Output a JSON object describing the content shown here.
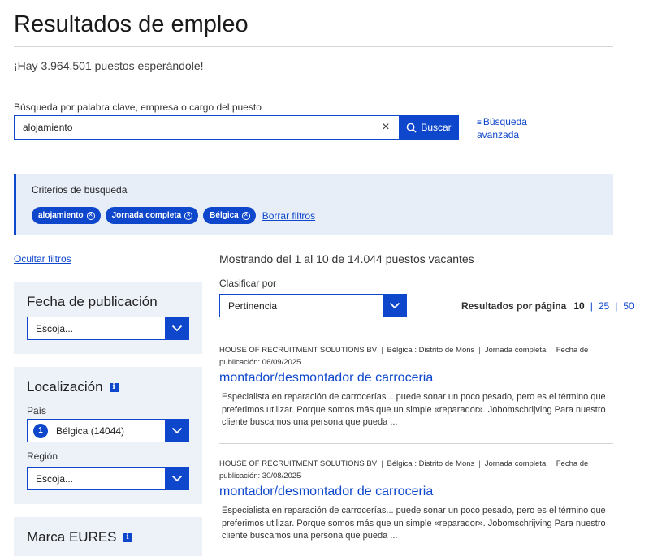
{
  "header": {
    "title": "Resultados de empleo",
    "subtitle": "¡Hay 3.964.501 puestos esperándole!"
  },
  "search": {
    "label": "Búsqueda por palabra clave, empresa o cargo del puesto",
    "value": "alojamiento",
    "clear_icon": "×",
    "button_label": "Buscar",
    "advanced_icon": "≡",
    "advanced_label": "Búsqueda avanzada"
  },
  "criteria": {
    "title": "Criterios de búsqueda",
    "chips": [
      "alojamiento",
      "Jornada completa",
      "Bélgica"
    ],
    "clear_label": "Borrar filtros"
  },
  "filters": {
    "hide_label": "Ocultar filtros",
    "publication_date": {
      "title": "Fecha de publicación",
      "value": "Escoja..."
    },
    "location": {
      "title": "Localización",
      "country_label": "País",
      "country_count": "1",
      "country_value": "Bélgica (14044)",
      "region_label": "Región",
      "region_value": "Escoja..."
    },
    "eures": {
      "title": "Marca EURES"
    }
  },
  "results": {
    "showing": "Mostrando del 1 al 10 de 14.044 puestos vacantes",
    "sort_label": "Clasificar por",
    "sort_value": "Pertinencia",
    "per_page_label": "Resultados por página",
    "per_page_options": [
      "10",
      "25",
      "50"
    ],
    "per_page_selected": "10"
  },
  "jobs": [
    {
      "company": "HOUSE OF RECRUITMENT SOLUTIONS BV",
      "location": "Bélgica : Distrito de Mons",
      "schedule": "Jornada completa",
      "date_label": "Fecha de publicación: 06/09/2025",
      "title": "montador/desmontador de carroceria",
      "description": "Especialista en reparación de carrocerías... puede sonar un poco pesado, pero es el término que preferimos utilizar. Porque somos más que un simple «reparador». Jobomschrijving Para nuestro cliente buscamos una persona que pueda ..."
    },
    {
      "company": "HOUSE OF RECRUITMENT SOLUTIONS BV",
      "location": "Bélgica : Distrito de Mons",
      "schedule": "Jornada completa",
      "date_label": "Fecha de publicación: 30/08/2025",
      "title": "montador/desmontador de carroceria",
      "description": "Especialista en reparación de carrocerías... puede sonar un poco pesado, pero es el término que preferimos utilizar. Porque somos más que un simple «reparador». Jobomschrijving Para nuestro cliente buscamos una persona que pueda ..."
    }
  ],
  "colors": {
    "accent": "#0e47cb",
    "panel_bg": "#edf1f8",
    "criteria_bg": "#e8eef8"
  }
}
